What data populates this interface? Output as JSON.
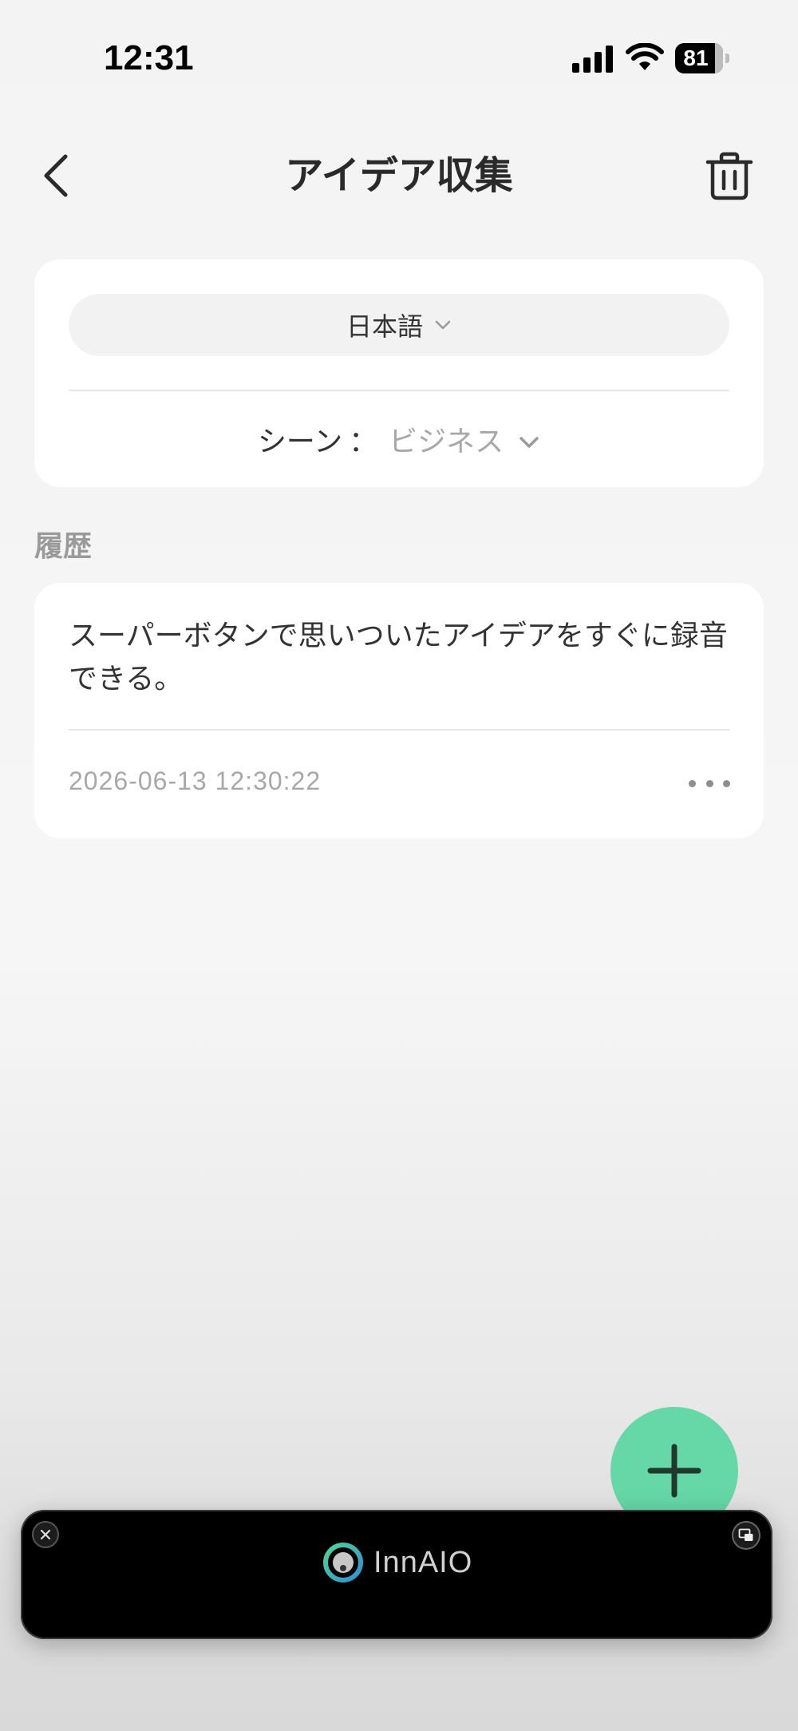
{
  "status_bar": {
    "time": "12:31",
    "battery_level": "81",
    "icons": [
      "signal-icon",
      "wifi-icon",
      "battery-icon"
    ]
  },
  "nav": {
    "title": "アイデア収集",
    "back_icon": "chevron-left-icon",
    "delete_icon": "trash-icon"
  },
  "settings": {
    "language": "日本語",
    "scene_label": "シーン",
    "scene_separator": "：",
    "scene_value": "ビジネス"
  },
  "history": {
    "heading": "履歴",
    "items": [
      {
        "text": "スーパーボタンで思いついたアイデアをすぐに録音できる。",
        "timestamp": "2026-06-13 12:30:22"
      }
    ]
  },
  "fab": {
    "icon": "plus-icon",
    "color": "#66d7a7"
  },
  "mini_player": {
    "brand": "InnAIO",
    "close_icon": "close-icon",
    "expand_icon": "picture-in-picture-icon"
  }
}
